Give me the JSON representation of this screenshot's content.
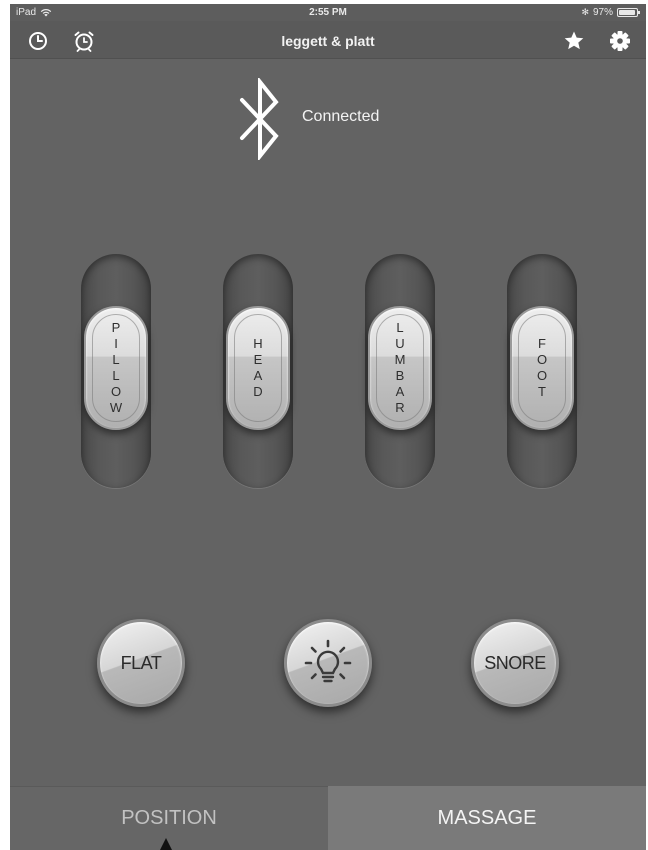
{
  "status_bar": {
    "device": "iPad",
    "time": "2:55 PM",
    "bluetooth_symbol": "✻",
    "battery": "97%",
    "battery_level": 0.97
  },
  "nav": {
    "title": "leggett & platt",
    "left_icons": [
      "clock-icon",
      "alarm-clock-icon"
    ],
    "right_icons": [
      "star-icon",
      "gear-icon"
    ]
  },
  "connection": {
    "icon": "bluetooth-icon",
    "status": "Connected"
  },
  "sliders": [
    {
      "label": "PILLOW"
    },
    {
      "label": "HEAD"
    },
    {
      "label": "LUMBAR"
    },
    {
      "label": "FOOT"
    }
  ],
  "buttons": {
    "flat": "FLAT",
    "light_icon": "light-bulb-icon",
    "snore": "SNORE"
  },
  "tabs": [
    {
      "label": "POSITION",
      "active": true
    },
    {
      "label": "MASSAGE",
      "active": false
    }
  ],
  "colors": {
    "background": "#636363",
    "nav": "#5a5a5a",
    "tab_active": "#666666",
    "tab_inactive": "#7a7a7a"
  }
}
